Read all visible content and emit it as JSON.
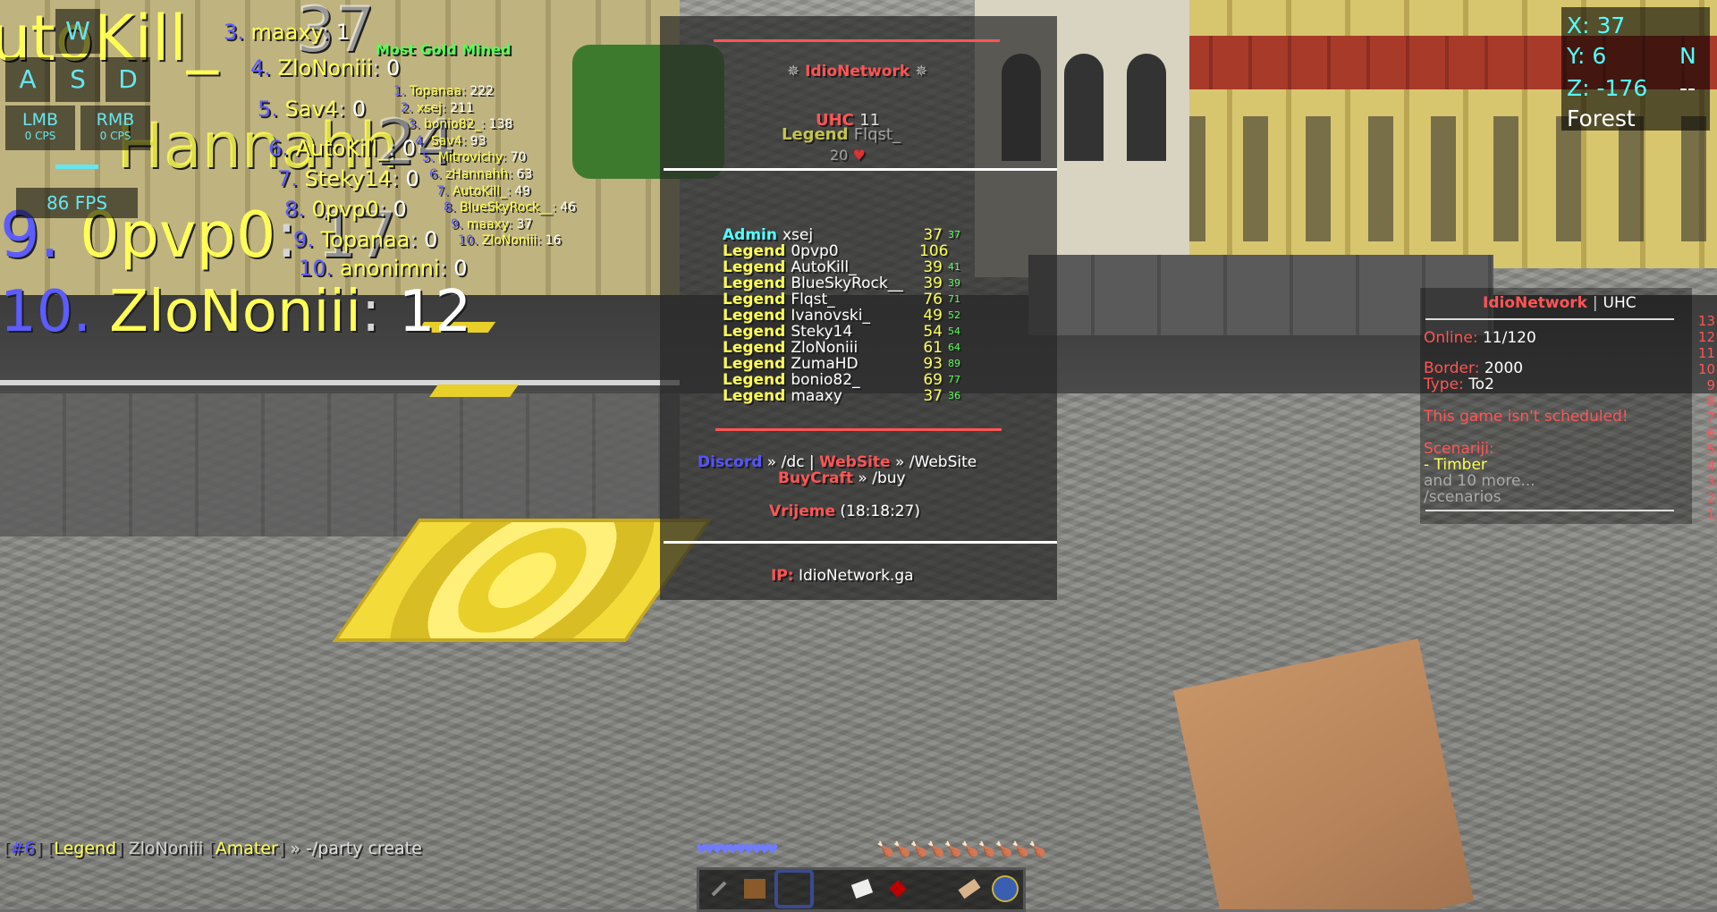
{
  "keystrokes": {
    "w": "W",
    "a": "A",
    "s": "S",
    "d": "D",
    "lmb": "LMB",
    "lmb_cps": "0 CPS",
    "rmb": "RMB",
    "rmb_cps": "0 CPS",
    "fps": "86 FPS"
  },
  "big_leaderboard": [
    {
      "num": "9.",
      "name": "0pvp0",
      "sep": ":",
      "value": "17"
    },
    {
      "num": "10.",
      "name": "ZloNoniii",
      "sep": ":",
      "value": "12"
    }
  ],
  "big_leaderboard_partial": {
    "top_name": "utoKill_",
    "top_value": "37",
    "mid_name": "Hannahh",
    "mid_value": "24"
  },
  "mid_leaderboard": [
    {
      "num": "3.",
      "name": "maaxy",
      "value": "1"
    },
    {
      "num": "4.",
      "name": "ZloNoniii",
      "value": "0"
    },
    {
      "num": "5.",
      "name": "Sav4",
      "value": "0"
    },
    {
      "num": "6.",
      "name": "AutoKill_",
      "value": "0"
    },
    {
      "num": "7.",
      "name": "Steky14",
      "value": "0"
    },
    {
      "num": "8.",
      "name": "0pvp0",
      "value": "0"
    },
    {
      "num": "9.",
      "name": "Topanaa",
      "value": "0"
    },
    {
      "num": "10.",
      "name": "anonimni",
      "value": "0"
    }
  ],
  "gold_title": "Most Gold Mined",
  "gold_leaderboard": [
    {
      "num": "1.",
      "name": "Topanaa",
      "value": "222"
    },
    {
      "num": "2.",
      "name": "xsej",
      "value": "211"
    },
    {
      "num": "3.",
      "name": "bonio82_",
      "value": "138"
    },
    {
      "num": "4.",
      "name": "Sav4",
      "value": "93"
    },
    {
      "num": "5.",
      "name": "Mitrovichy",
      "value": "70"
    },
    {
      "num": "6.",
      "name": "zHannahh",
      "value": "63"
    },
    {
      "num": "7.",
      "name": "AutoKill_",
      "value": "49"
    },
    {
      "num": "8.",
      "name": "BlueSkyRock__",
      "value": "46"
    },
    {
      "num": "9.",
      "name": "maaxy",
      "value": "37"
    },
    {
      "num": "10.",
      "name": "ZloNoniii",
      "value": "16"
    }
  ],
  "tab": {
    "server_name": "IdioNetwork",
    "star": "✵",
    "uhc": "UHC",
    "uhc_count": "11",
    "nametag_rank": "Legend",
    "nametag_name": "Flqst_",
    "nametag_hp": "20",
    "players": [
      {
        "rank": "Admin",
        "name": "xsej",
        "hp": "37",
        "ping": "37",
        "admin": true
      },
      {
        "rank": "Legend",
        "name": "0pvp0",
        "hp": "106",
        "ping": "",
        "admin": false
      },
      {
        "rank": "Legend",
        "name": "AutoKill_",
        "hp": "39",
        "ping": "41",
        "admin": false
      },
      {
        "rank": "Legend",
        "name": "BlueSkyRock__",
        "hp": "39",
        "ping": "39",
        "admin": false
      },
      {
        "rank": "Legend",
        "name": "Flqst_",
        "hp": "76",
        "ping": "71",
        "admin": false
      },
      {
        "rank": "Legend",
        "name": "Ivanovski_",
        "hp": "49",
        "ping": "52",
        "admin": false
      },
      {
        "rank": "Legend",
        "name": "Steky14",
        "hp": "54",
        "ping": "54",
        "admin": false
      },
      {
        "rank": "Legend",
        "name": "ZloNoniii",
        "hp": "61",
        "ping": "64",
        "admin": false
      },
      {
        "rank": "Legend",
        "name": "ZumaHD",
        "hp": "93",
        "ping": "89",
        "admin": false
      },
      {
        "rank": "Legend",
        "name": "bonio82_",
        "hp": "69",
        "ping": "77",
        "admin": false
      },
      {
        "rank": "Legend",
        "name": "maaxy",
        "hp": "37",
        "ping": "36",
        "admin": false
      }
    ],
    "footer": {
      "discord_label": "Discord",
      "discord_cmd": "» /dc |",
      "website_label": "WebSite",
      "website_cmd": "» /WebSite",
      "buycraft_label": "BuyCraft",
      "buycraft_cmd": "» /buy",
      "time_label": "Vrijeme",
      "time_value": "18:18:27",
      "ip_label": "IP:",
      "ip_value": "IdioNetwork.ga"
    }
  },
  "scoreboard": {
    "title_server": "IdioNetwork",
    "title_sep": "|",
    "title_mode": "UHC",
    "online_label": "Online:",
    "online_value": "11/120",
    "border_label": "Border:",
    "border_value": "2000",
    "type_label": "Type:",
    "type_value": "To2",
    "schedule_msg": "This game isn't scheduled!",
    "scenarios_label": "Scenariji:",
    "scenario_1": "- Timber",
    "more": "and 10 more...",
    "cmd": "/scenarios",
    "line_numbers": [
      "13",
      "12",
      "11",
      "10",
      "9",
      "8",
      "7",
      "6",
      "5",
      "4",
      "3",
      "2",
      "1"
    ]
  },
  "coords": {
    "x": "X: 37",
    "y": "Y: 6",
    "z": "Z: -176",
    "dir": "N",
    "dir2": "--",
    "biome": "Forest"
  },
  "chat": {
    "level": "#6",
    "rank": "Legend",
    "name": "ZloNoniii",
    "tag": "Amater",
    "message": "» -/party create"
  },
  "colors": {
    "red": "#ff5555",
    "gold": "#ffff55",
    "aqua": "#55ffff",
    "blue": "#5555ff",
    "green": "#55ff55"
  }
}
